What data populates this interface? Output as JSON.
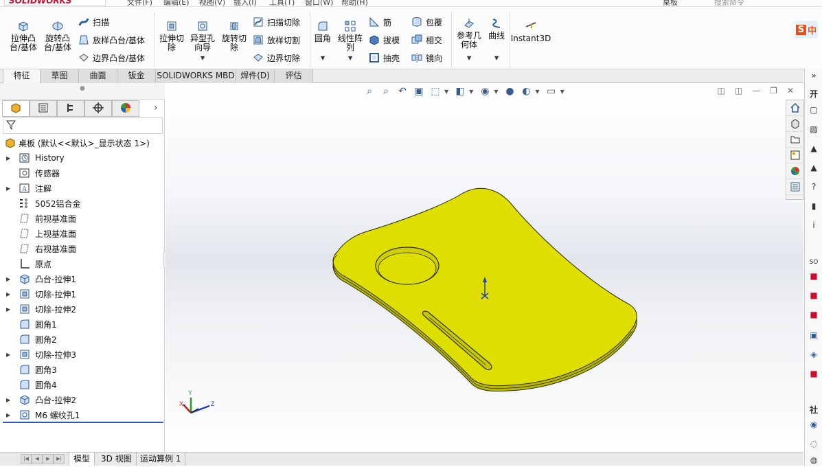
{
  "app": {
    "logo": "SOLIDWORKS",
    "doc_name": "桌板",
    "search_placeholder": "搜索命令"
  },
  "menu": [
    "文件(F)",
    "编辑(E)",
    "视图(V)",
    "插入(I)",
    "工具(T)",
    "窗口(W)",
    "帮助(H)"
  ],
  "ribbon": {
    "extrude_boss": "拉伸凸\n台/基体",
    "revolve_boss": "旋转凸\n台/基体",
    "sweep": "扫描",
    "loft_boss": "放样凸台/基体",
    "boundary_boss": "边界凸台/基体",
    "extrude_cut": "拉伸切\n除",
    "hole_wizard": "异型孔\n向导",
    "revolve_cut": "旋转切\n除",
    "swept_cut": "扫描切除",
    "lofted_cut": "放样切割",
    "boundary_cut": "边界切除",
    "fillet": "圆角",
    "linear_pattern": "线性阵\n列",
    "rib": "筋",
    "draft": "拔模",
    "shell": "抽壳",
    "wrap": "包覆",
    "intersect": "相交",
    "mirror": "镜向",
    "ref_geometry": "参考几\n何体",
    "curves": "曲线",
    "instant3d": "Instant3D",
    "sogou": "中"
  },
  "tabs": [
    "特征",
    "草图",
    "曲面",
    "钣金",
    "SOLIDWORKS MBD",
    "焊件(D)",
    "评估"
  ],
  "tree": {
    "root": "桌板 (默认<<默认>_显示状态 1>)",
    "items": [
      {
        "label": "History",
        "expandable": true,
        "icon": "history-icon"
      },
      {
        "label": "传感器",
        "expandable": false,
        "icon": "sensor-icon"
      },
      {
        "label": "注解",
        "expandable": true,
        "icon": "annotation-icon"
      },
      {
        "label": "5052铝合金",
        "expandable": false,
        "icon": "material-icon"
      },
      {
        "label": "前视基准面",
        "expandable": false,
        "icon": "plane-icon"
      },
      {
        "label": "上视基准面",
        "expandable": false,
        "icon": "plane-icon"
      },
      {
        "label": "右视基准面",
        "expandable": false,
        "icon": "plane-icon"
      },
      {
        "label": "原点",
        "expandable": false,
        "icon": "origin-icon"
      },
      {
        "label": "凸台-拉伸1",
        "expandable": true,
        "icon": "boss-extrude-icon"
      },
      {
        "label": "切除-拉伸1",
        "expandable": true,
        "icon": "cut-extrude-icon"
      },
      {
        "label": "切除-拉伸2",
        "expandable": true,
        "icon": "cut-extrude-icon"
      },
      {
        "label": "圆角1",
        "expandable": false,
        "icon": "fillet-icon"
      },
      {
        "label": "圆角2",
        "expandable": false,
        "icon": "fillet-icon"
      },
      {
        "label": "切除-拉伸3",
        "expandable": true,
        "icon": "cut-extrude-icon"
      },
      {
        "label": "圆角3",
        "expandable": false,
        "icon": "fillet-icon"
      },
      {
        "label": "圆角4",
        "expandable": false,
        "icon": "fillet-icon"
      },
      {
        "label": "凸台-拉伸2",
        "expandable": true,
        "icon": "boss-extrude-icon"
      },
      {
        "label": "M6 螺纹孔1",
        "expandable": true,
        "icon": "hole-icon"
      }
    ]
  },
  "triad": {
    "x": "X",
    "y": "Y",
    "z": "Z"
  },
  "bottom_tabs": [
    "模型",
    "3D 视图",
    "运动算例 1"
  ],
  "task_pane": {
    "label_1": "开",
    "label_2": "SO",
    "label_3": "社"
  },
  "colors": {
    "part_fill": "#dede00",
    "part_edge": "#2a2a00",
    "accent": "#2b57b8"
  }
}
